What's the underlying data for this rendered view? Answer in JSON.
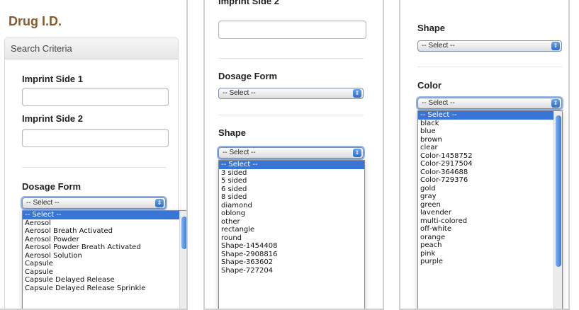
{
  "panel1": {
    "app_title": "Drug I.D.",
    "criteria_header": "Search Criteria",
    "imprint1_label": "Imprint Side 1",
    "imprint1_value": "",
    "imprint2_label": "Imprint Side 2",
    "imprint2_value": "",
    "dosage_label": "Dosage Form",
    "dosage_selected": "-- Select --",
    "dosage_options": [
      "-- Select --",
      "Aerosol",
      "Aerosol Breath Activated",
      "Aerosol Powder",
      "Aerosol Powder Breath Activated",
      "Aerosol Solution",
      "Capsule",
      "Capsule",
      "Capsule Delayed Release",
      "Capsule Delayed Release Sprinkle"
    ]
  },
  "panel2": {
    "imprint2_label": "Imprint Side 2",
    "imprint2_value": "",
    "dosage_label": "Dosage Form",
    "dosage_selected": "-- Select --",
    "shape_label": "Shape",
    "shape_selected": "-- Select --",
    "shape_options": [
      "-- Select --",
      "3 sided",
      "5 sided",
      "6 sided",
      "8 sided",
      "diamond",
      "oblong",
      "other",
      "rectangle",
      "round",
      "Shape-1454408",
      "Shape-2908816",
      "Shape-363602",
      "Shape-727204"
    ]
  },
  "panel3": {
    "shape_label": "Shape",
    "shape_selected": "-- Select --",
    "color_label": "Color",
    "color_selected": "-- Select --",
    "color_options": [
      "-- Select --",
      "black",
      "blue",
      "brown",
      "clear",
      "Color-1458752",
      "Color-2917504",
      "Color-364688",
      "Color-729376",
      "gold",
      "gray",
      "green",
      "lavender",
      "multi-colored",
      "off-white",
      "orange",
      "peach",
      "pink",
      "purple"
    ]
  },
  "colors": {
    "title_brown": "#8a5a2a",
    "selection_blue": "#3875d7",
    "focus_ring": "#8fb3e8"
  },
  "icons": {
    "select_arrow": "up-down-chevron-icon",
    "scroll_thumb": "scrollbar-thumb"
  }
}
